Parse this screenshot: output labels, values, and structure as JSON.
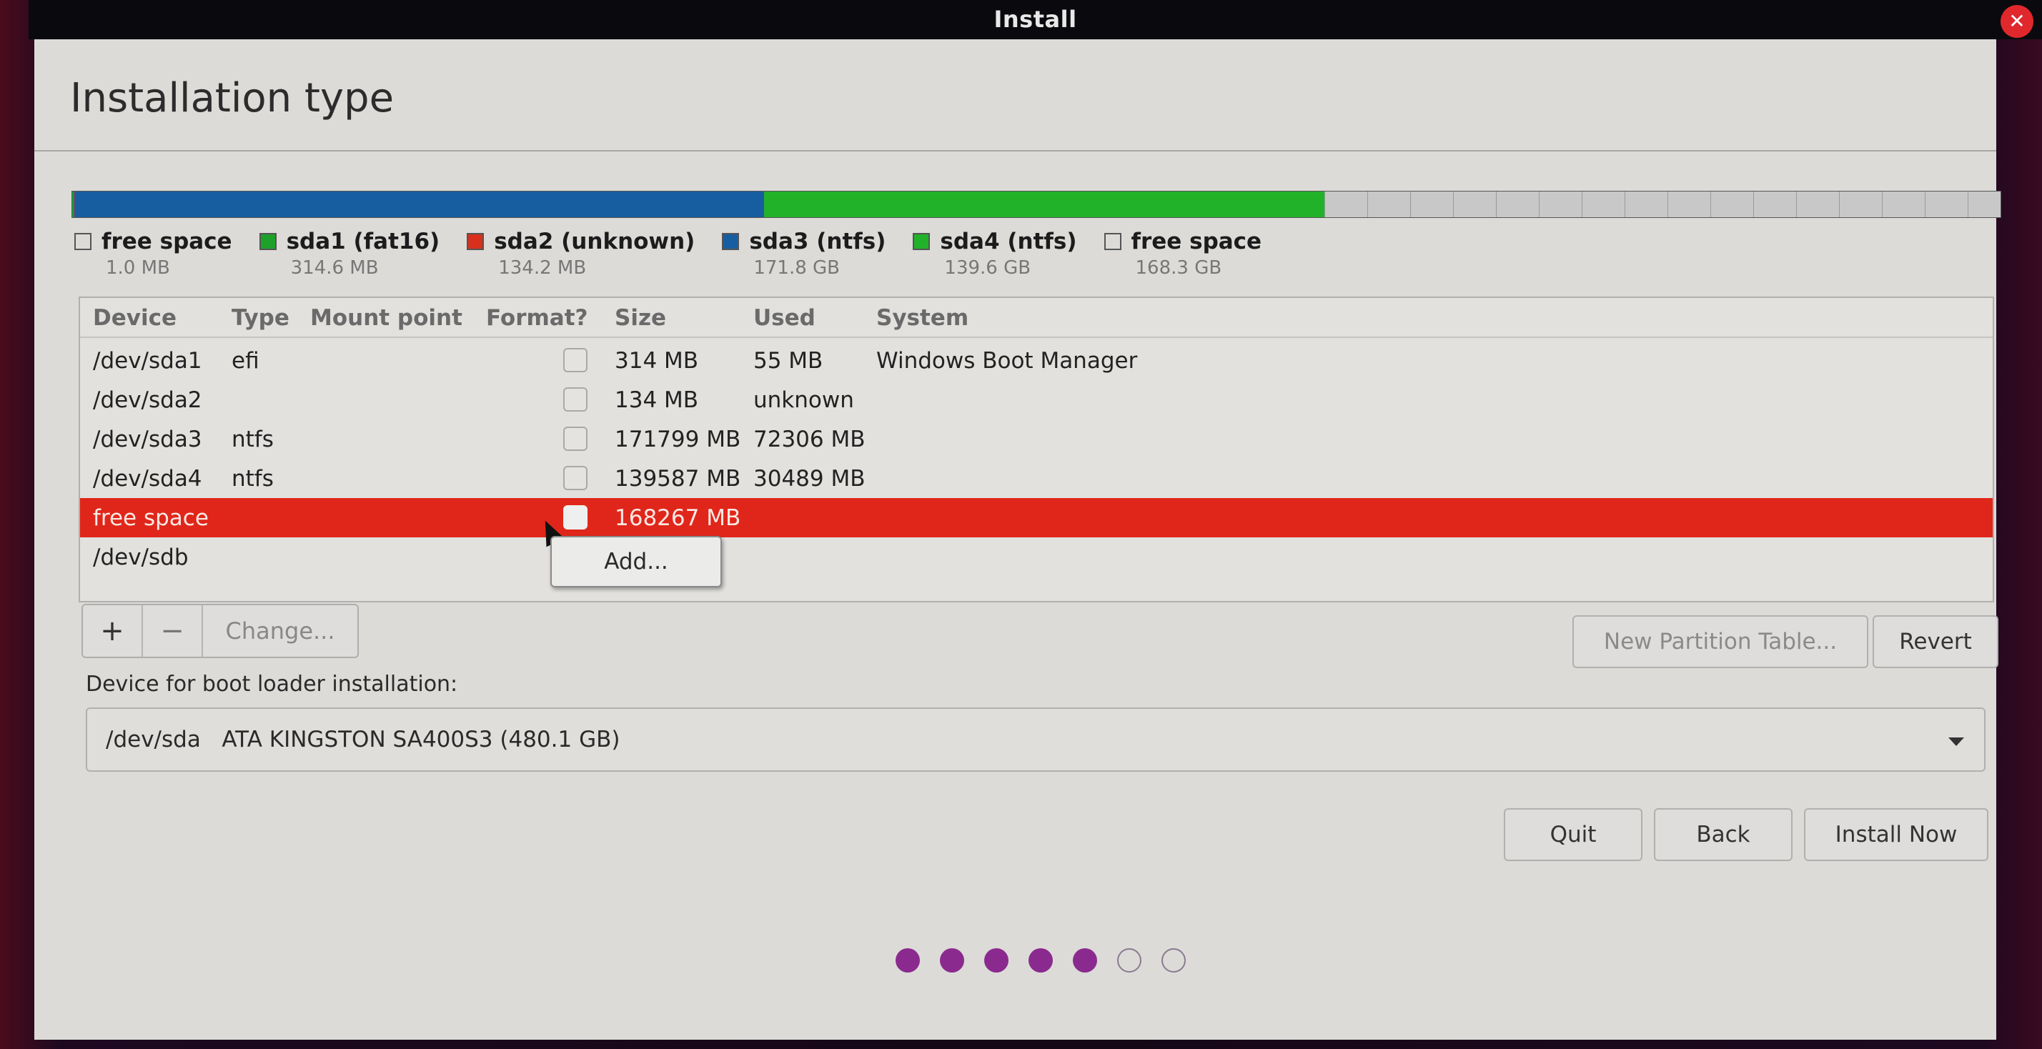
{
  "window": {
    "title": "Install",
    "close_icon": "close-icon"
  },
  "page": {
    "title": "Installation type"
  },
  "colors": {
    "free_space": "#c03030",
    "sda1": "#1ea12a",
    "sda2": "#d8301c",
    "sda3": "#175ea0",
    "sda4": "#22b22a",
    "selection": "#e0261a",
    "progress_dot": "#8b2a8e",
    "close_button": "#e0282c"
  },
  "partition_bar": {
    "unit": "GB",
    "segments": [
      {
        "id": "free1",
        "name": "free space",
        "size_gb": 0.001
      },
      {
        "id": "sda1",
        "name": "sda1 (fat16)",
        "size_gb": 0.3146
      },
      {
        "id": "sda2",
        "name": "sda2 (unknown)",
        "size_gb": 0.1342
      },
      {
        "id": "sda3",
        "name": "sda3 (ntfs)",
        "size_gb": 171.8
      },
      {
        "id": "sda4",
        "name": "sda4 (ntfs)",
        "size_gb": 139.6
      },
      {
        "id": "free2",
        "name": "free space",
        "size_gb": 168.3
      }
    ]
  },
  "legend": [
    {
      "name": "free space",
      "size": "1.0 MB",
      "swatch": "empty"
    },
    {
      "name": "sda1 (fat16)",
      "size": "314.6 MB",
      "swatch": "#1ea12a"
    },
    {
      "name": "sda2 (unknown)",
      "size": "134.2 MB",
      "swatch": "#d8301c"
    },
    {
      "name": "sda3 (ntfs)",
      "size": "171.8 GB",
      "swatch": "#175ea0"
    },
    {
      "name": "sda4 (ntfs)",
      "size": "139.6 GB",
      "swatch": "#22b22a"
    },
    {
      "name": "free space",
      "size": "168.3 GB",
      "swatch": "empty"
    }
  ],
  "table": {
    "headers": {
      "device": "Device",
      "type": "Type",
      "mount": "Mount point",
      "format": "Format?",
      "size": "Size",
      "used": "Used",
      "system": "System"
    },
    "rows": [
      {
        "device": "/dev/sda1",
        "type": "efi",
        "mount": "",
        "format": false,
        "size": "314 MB",
        "used": "55 MB",
        "system": "Windows Boot Manager"
      },
      {
        "device": "/dev/sda2",
        "type": "",
        "mount": "",
        "format": false,
        "size": "134 MB",
        "used": "unknown",
        "system": ""
      },
      {
        "device": "/dev/sda3",
        "type": "ntfs",
        "mount": "",
        "format": false,
        "size": "171799 MB",
        "used": "72306 MB",
        "system": ""
      },
      {
        "device": "/dev/sda4",
        "type": "ntfs",
        "mount": "",
        "format": false,
        "size": "139587 MB",
        "used": "30489 MB",
        "system": ""
      },
      {
        "device": "free space",
        "type": "",
        "mount": "",
        "format": false,
        "size": "168267 MB",
        "used": "",
        "system": "",
        "selected": true
      },
      {
        "device": "/dev/sdb",
        "type": "",
        "mount": "",
        "format": null,
        "size": "",
        "used": "",
        "system": ""
      }
    ]
  },
  "context_popup": {
    "label": "Add..."
  },
  "toolbar": {
    "add_label": "+",
    "remove_label": "−",
    "change_label": "Change...",
    "new_partition_table_label": "New Partition Table...",
    "revert_label": "Revert"
  },
  "boot_loader": {
    "label": "Device for boot loader installation:",
    "selected": "/dev/sda   ATA KINGSTON SA400S3 (480.1 GB)"
  },
  "nav": {
    "quit_label": "Quit",
    "back_label": "Back",
    "install_label": "Install Now"
  },
  "progress": {
    "total_steps": 7,
    "completed_steps": 5
  }
}
